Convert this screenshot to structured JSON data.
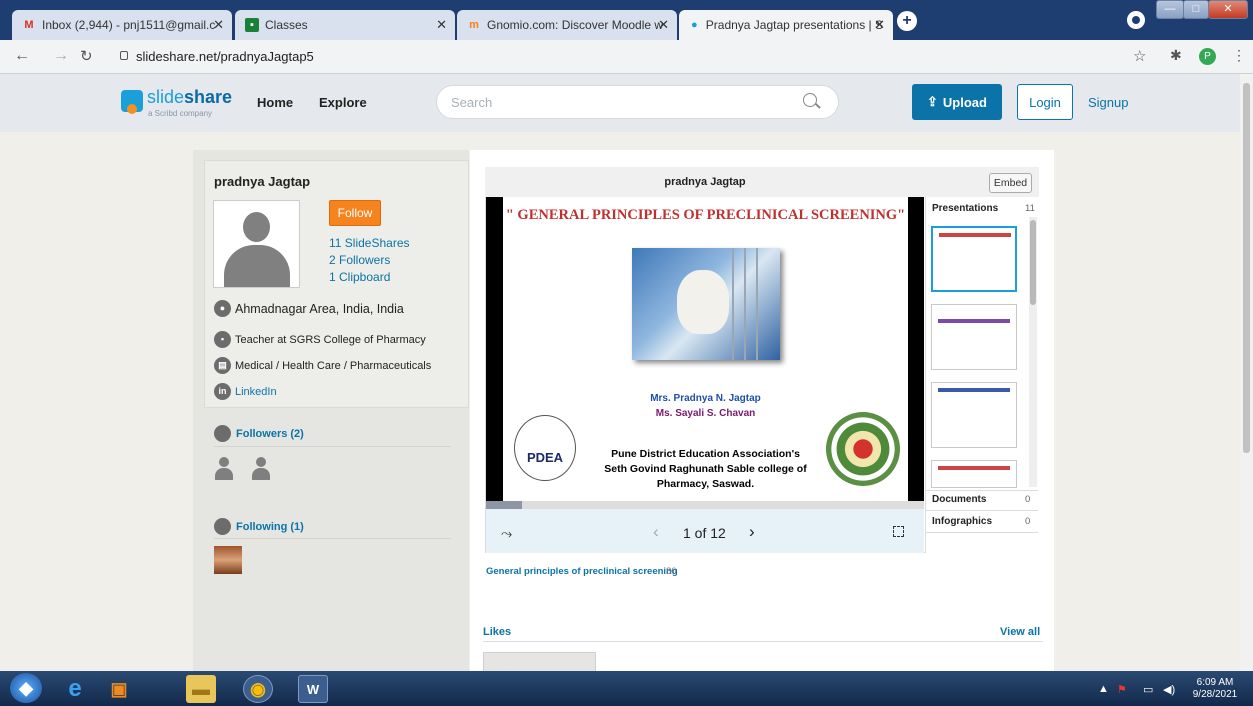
{
  "browser": {
    "tabs": [
      {
        "title": "Inbox (2,944) - pnj1511@gmail.c",
        "icon": "gmail-icon"
      },
      {
        "title": "Classes",
        "icon": "classes-icon"
      },
      {
        "title": "Gnomio.com: Discover Moodle w",
        "icon": "moodle-icon"
      },
      {
        "title": "Pradnya Jagtap presentations | S",
        "icon": "slideshare-icon"
      }
    ],
    "url": "slideshare.net/pradnyaJagtap5",
    "profile_initial": "P"
  },
  "header": {
    "logo_text": "slide",
    "logo_text_bold": "share",
    "logo_sub": "a Scribd company",
    "nav": [
      "Home",
      "Explore"
    ],
    "search_placeholder": "Search",
    "upload_label": "Upload",
    "login_label": "Login",
    "signup_label": "Signup"
  },
  "profile": {
    "name": "pradnya Jagtap",
    "follow_label": "Follow",
    "slideshares": "11 SlideShares",
    "followers": "2 Followers",
    "clipboard": "1 Clipboard",
    "location": "Ahmadnagar Area, India, India",
    "job": "Teacher at SGRS College of Pharmacy",
    "industry": "Medical / Health Care / Pharmaceuticals",
    "linkedin": "LinkedIn",
    "followers_heading": "Followers (2)",
    "following_heading": "Following (1)"
  },
  "viewer": {
    "title": "pradnya Jagtap",
    "embed_label": "Embed",
    "slide_title": "\" GENERAL PRINCIPLES OF PRECLINICAL SCREENING\"",
    "authors": [
      "Mrs. Pradnya N. Jagtap",
      "Ms.  Sayali S. Chavan"
    ],
    "institution": [
      "Pune District Education Association's",
      "Seth Govind Raghunath Sable college of",
      "Pharmacy, Saswad."
    ],
    "pdea_logo": "PDEA",
    "pager": "1 of 12",
    "progress": 0.083
  },
  "sidebar": {
    "presentations_label": "Presentations",
    "presentations_count": "11",
    "documents_label": "Documents",
    "documents_count": "0",
    "infographics_label": "Infographics",
    "infographics_count": "0"
  },
  "deck": {
    "link": "General principles of preclinical screening",
    "views": "80"
  },
  "likes": {
    "heading": "Likes",
    "view_all": "View all"
  },
  "taskbar": {
    "time": "6:09 AM",
    "date": "9/28/2021"
  },
  "colors": {
    "accent": "#0b73a8",
    "follow": "#f5841f",
    "slide_title": "#c0302e"
  }
}
